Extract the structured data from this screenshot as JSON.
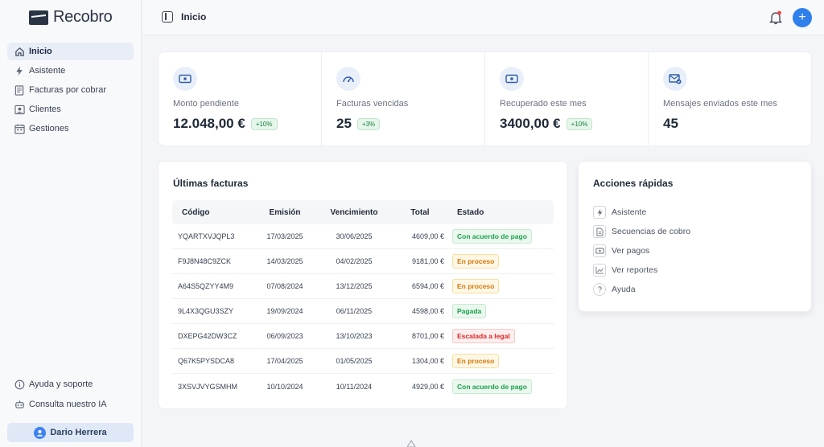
{
  "app": {
    "name": "Recobro"
  },
  "sidebar": {
    "items": [
      {
        "label": "Inicio",
        "icon": "home-icon"
      },
      {
        "label": "Asistente",
        "icon": "lightning-icon"
      },
      {
        "label": "Facturas por cobrar",
        "icon": "invoice-icon"
      },
      {
        "label": "Clientes",
        "icon": "contacts-icon"
      },
      {
        "label": "Gestiones",
        "icon": "calendar-icon"
      }
    ],
    "bottom": [
      {
        "label": "Ayuda y soporte",
        "icon": "info-icon"
      },
      {
        "label": "Consulta nuestro IA",
        "icon": "robot-icon"
      }
    ],
    "user": "Dario Herrera"
  },
  "header": {
    "title": "Inicio"
  },
  "stats": [
    {
      "label": "Monto pendiente",
      "value": "12.048,00 €",
      "badge": "+10%",
      "icon": "cash-icon"
    },
    {
      "label": "Facturas vencidas",
      "value": "25",
      "badge": "+3%",
      "icon": "gauge-icon"
    },
    {
      "label": "Recuperado este mes",
      "value": "3400,00 €",
      "badge": "+10%",
      "icon": "cash-icon"
    },
    {
      "label": "Mensajes enviados este mes",
      "value": "45",
      "badge": "",
      "icon": "mail-check-icon"
    }
  ],
  "invoices": {
    "title": "Últimas facturas",
    "columns": [
      "Código",
      "Emisión",
      "Vencimiento",
      "Total",
      "Estado"
    ],
    "rows": [
      {
        "code": "YQARTXVJQPL3",
        "issued": "17/03/2025",
        "due": "30/06/2025",
        "total": "4609,00 €",
        "status": "Con acuerdo de pago",
        "tone": "green"
      },
      {
        "code": "F9J8N48C9ZCK",
        "issued": "14/03/2025",
        "due": "04/02/2025",
        "total": "9181,00 €",
        "status": "En proceso",
        "tone": "yellow"
      },
      {
        "code": "A64S5QZYY4M9",
        "issued": "07/08/2024",
        "due": "13/12/2025",
        "total": "6594,00 €",
        "status": "En proceso",
        "tone": "yellow"
      },
      {
        "code": "9L4X3QGU3SZY",
        "issued": "19/09/2024",
        "due": "06/11/2025",
        "total": "4598,00 €",
        "status": "Pagada",
        "tone": "green"
      },
      {
        "code": "DXEPG42DW3CZ",
        "issued": "06/09/2023",
        "due": "13/10/2023",
        "total": "8701,00 €",
        "status": "Escalada a legal",
        "tone": "red"
      },
      {
        "code": "Q67K5PYSDCA8",
        "issued": "17/04/2025",
        "due": "01/05/2025",
        "total": "1304,00 €",
        "status": "En proceso",
        "tone": "yellow"
      },
      {
        "code": "3XSVJVYGSMHM",
        "issued": "10/10/2024",
        "due": "10/11/2024",
        "total": "4929,00 €",
        "status": "Con acuerdo de pago",
        "tone": "green"
      }
    ]
  },
  "quick_actions": {
    "title": "Acciones rápidas",
    "items": [
      {
        "label": "Asistente",
        "icon": "lightning-icon"
      },
      {
        "label": "Secuencias de cobro",
        "icon": "document-icon"
      },
      {
        "label": "Ver pagos",
        "icon": "cash-icon"
      },
      {
        "label": "Ver reportes",
        "icon": "chart-line-icon"
      },
      {
        "label": "Ayuda",
        "icon": "help-icon"
      }
    ]
  },
  "colors": {
    "accent": "#2f80ed",
    "success": "#16a34a",
    "warning": "#d97706",
    "danger": "#dc2626"
  }
}
